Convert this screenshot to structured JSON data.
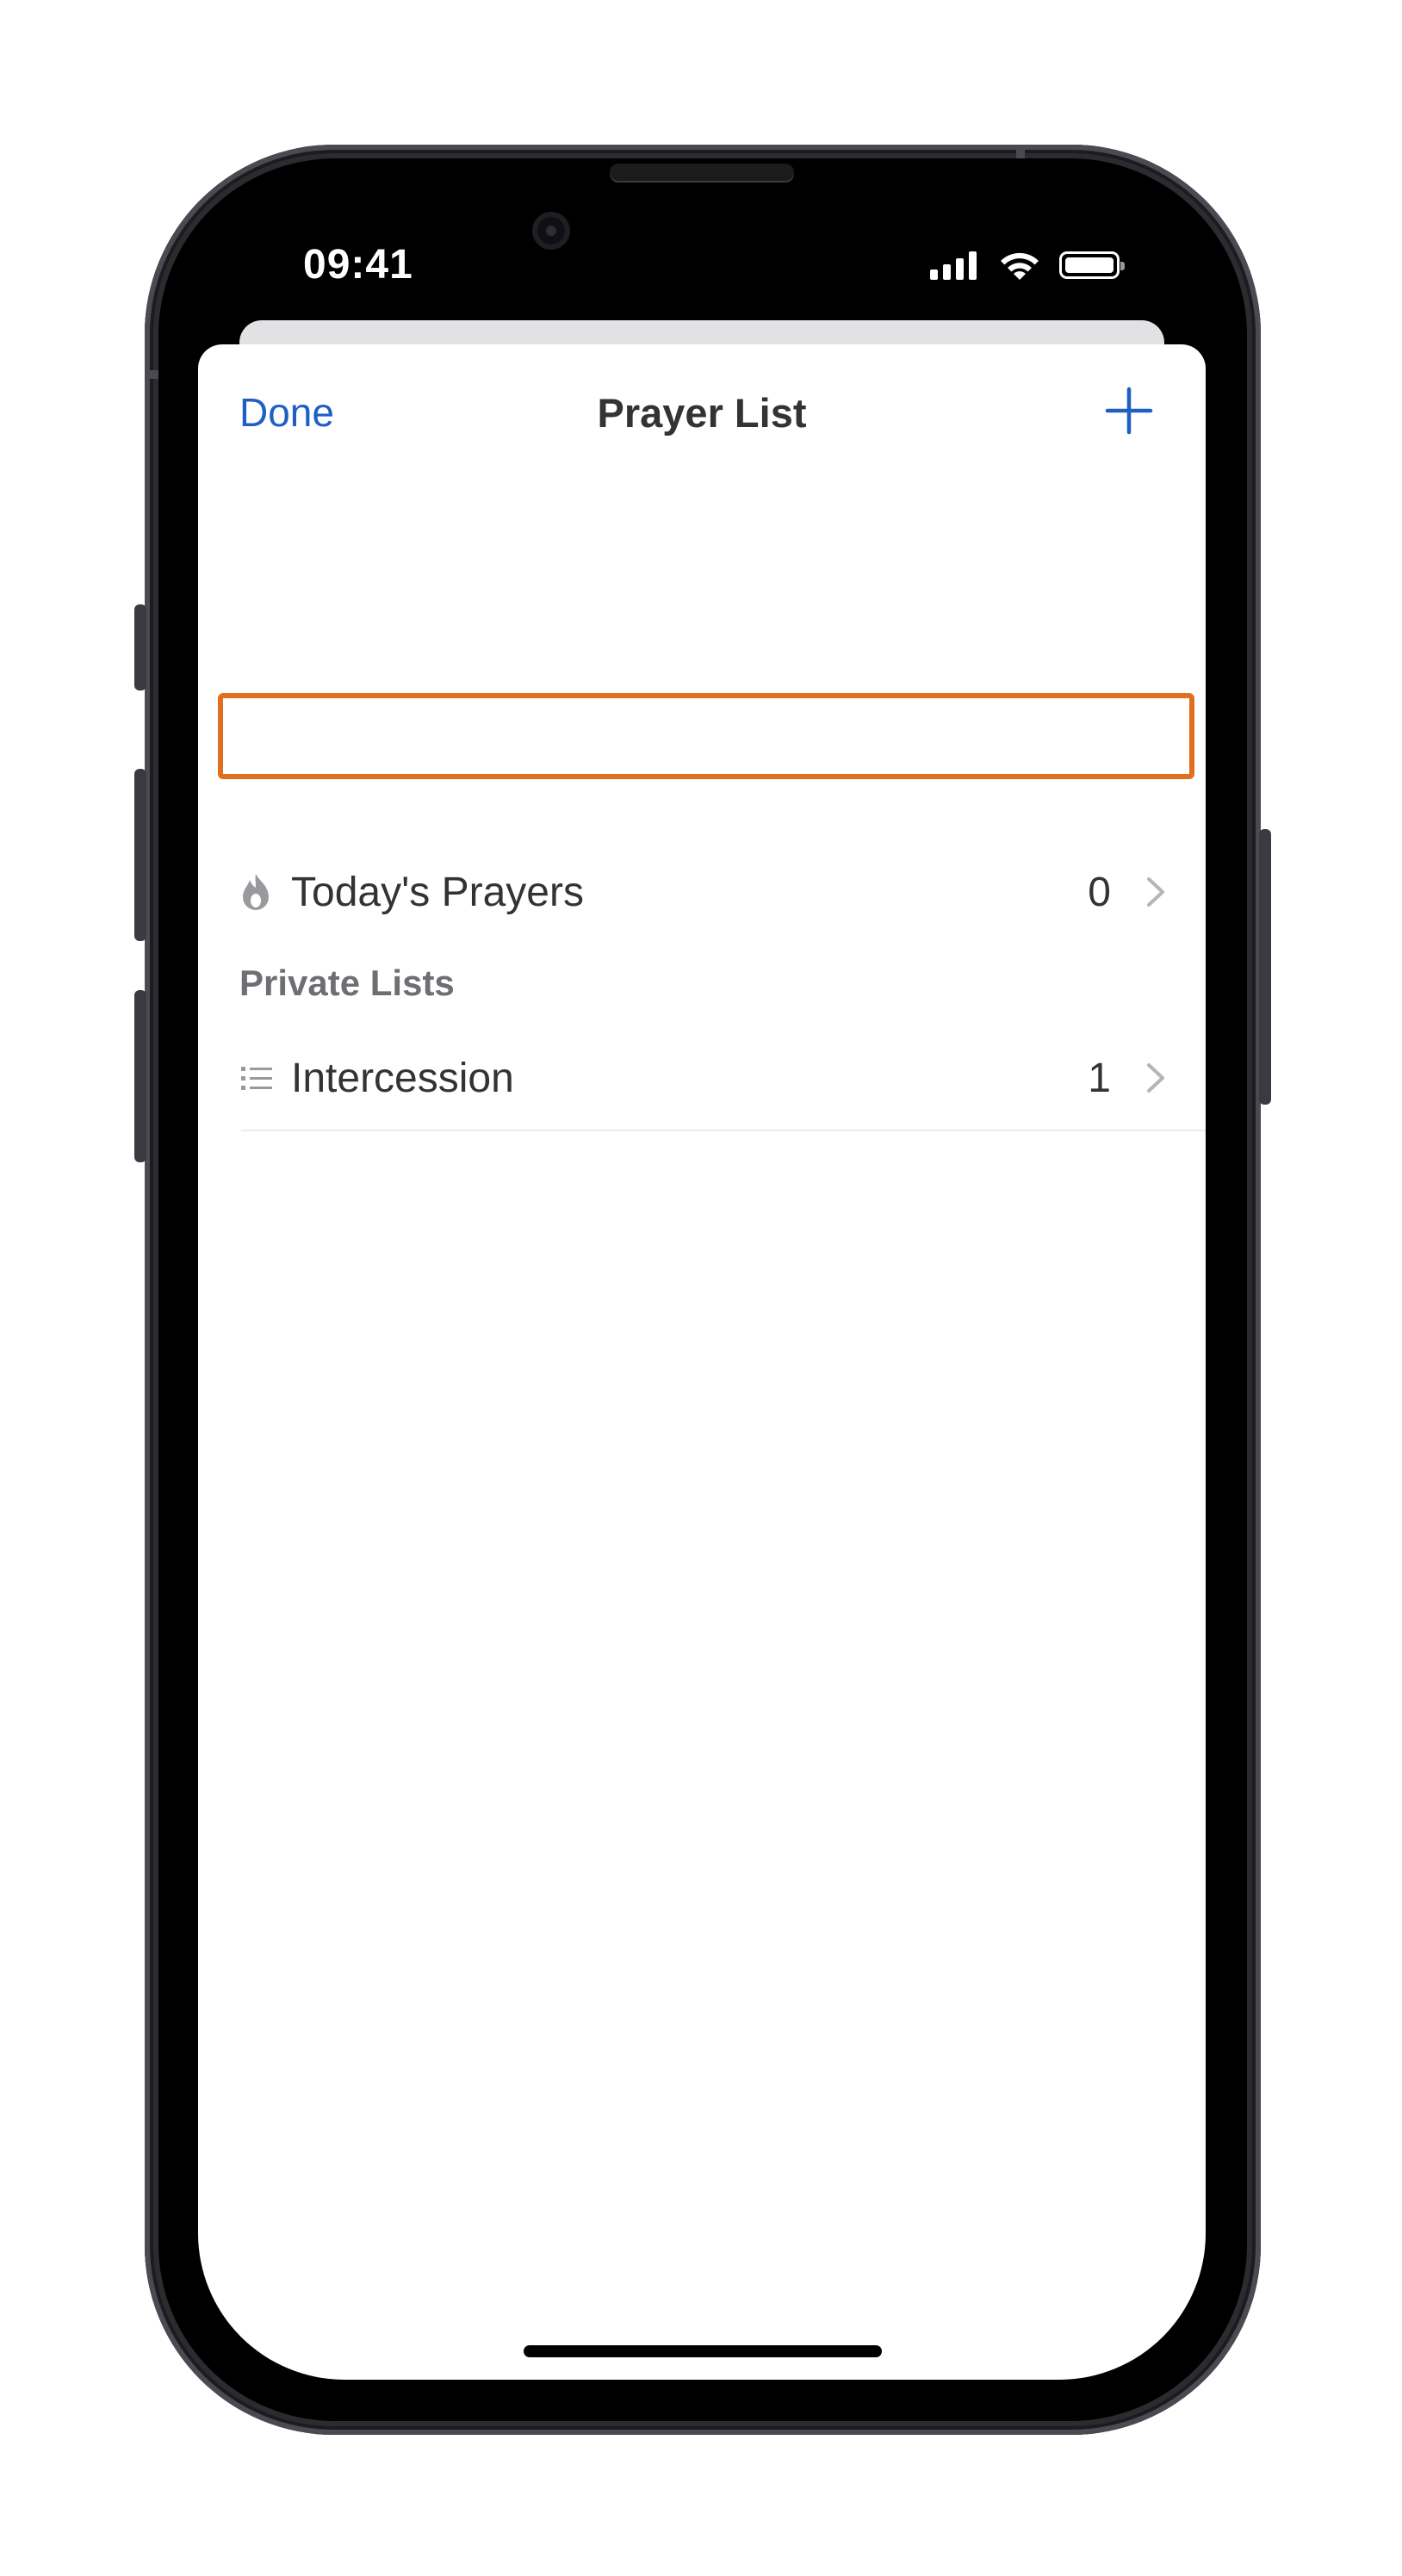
{
  "status_bar": {
    "time": "09:41",
    "icons": [
      "cellular-signal-icon",
      "wifi-icon",
      "battery-icon"
    ]
  },
  "nav": {
    "done_label": "Done",
    "title": "Prayer List",
    "add_icon": "plus-icon"
  },
  "todays_prayers": {
    "icon": "flame-icon",
    "label": "Today's Prayers",
    "count": "0"
  },
  "private_lists": {
    "header": "Private Lists",
    "items": [
      {
        "icon": "list-icon",
        "label": "Intercession",
        "count": "1"
      }
    ]
  },
  "colors": {
    "accent": "#1f5fc5",
    "highlight": "#e07020",
    "text": "#333333",
    "section_header": "#6e6e73",
    "icon_gray": "#9a9a9e"
  }
}
